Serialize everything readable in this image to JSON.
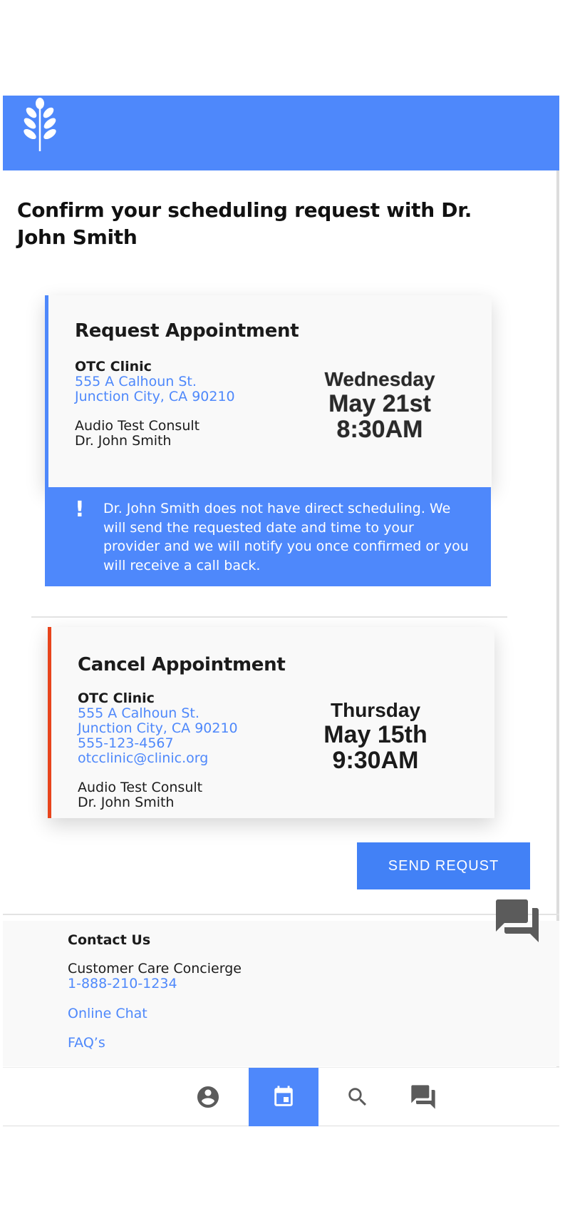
{
  "page": {
    "title": "Confirm your scheduling request with Dr. John Smith"
  },
  "header": {
    "logo_icon": "wheat-leaf-icon",
    "background": "#4e88fb"
  },
  "request_card": {
    "title": "Request Appointment",
    "clinic_name": "OTC Clinic",
    "address_line1": "555 A Calhoun St.",
    "address_line2": "Junction City, CA 90210",
    "service": "Audio Test Consult",
    "provider": "Dr. John Smith",
    "day": "Wednesday",
    "date": "May 21st",
    "time": "8:30AM",
    "accent_color": "#4e88fb"
  },
  "notice": {
    "icon": "exclamation-icon",
    "text": "Dr. John Smith does not have direct scheduling. We will send the requested date and time to your provider and we will notify you once confirmed or you will receive a call back."
  },
  "cancel_card": {
    "title": "Cancel Appointment",
    "clinic_name": "OTC Clinic",
    "address_line1": "555 A Calhoun St.",
    "address_line2": "Junction City, CA 90210",
    "phone": "555-123-4567",
    "email": "otcclinic@clinic.org",
    "service": "Audio Test Consult",
    "provider": "Dr. John Smith",
    "day": "Thursday",
    "date": "May 15th",
    "time": "9:30AM",
    "accent_color": "#e8441c"
  },
  "actions": {
    "send_label": "SEND REQUST",
    "chat_icon": "chat-bubbles-icon"
  },
  "footer": {
    "contact_title": "Contact Us",
    "concierge_label": "Customer Care Concierge",
    "concierge_phone": "1-888-210-1234",
    "online_chat": "Online Chat",
    "faq": "FAQ’s"
  },
  "bottom_nav": {
    "items": [
      {
        "icon": "account-circle-icon",
        "active": false
      },
      {
        "icon": "calendar-icon",
        "active": true
      },
      {
        "icon": "search-icon",
        "active": false
      },
      {
        "icon": "chat-bubbles-icon",
        "active": false
      }
    ],
    "active_color": "#4e88fb"
  }
}
